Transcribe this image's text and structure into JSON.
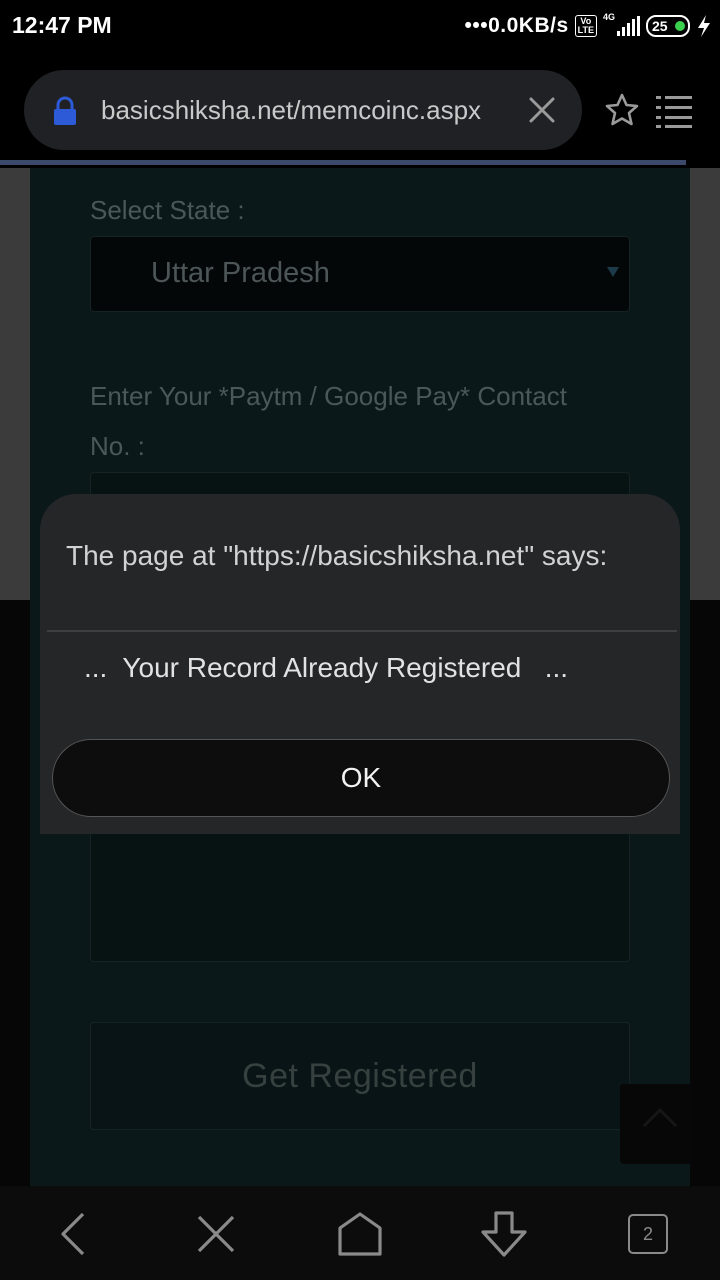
{
  "status_bar": {
    "time": "12:47 PM",
    "net_speed": "•••0.0KB/s",
    "volte_label": "Vo\nLTE",
    "network_type": "4G",
    "battery_level": "25",
    "icons": [
      "volte-icon",
      "signal-icon",
      "battery-icon",
      "charging-icon"
    ]
  },
  "browser": {
    "url": "basicshiksha.net/memcoinc.aspx",
    "icons": [
      "lock-icon",
      "clear-icon",
      "star-icon",
      "menu-icon"
    ]
  },
  "form": {
    "state_label": "Select State :",
    "state_value": "Uttar Pradesh",
    "contact_label_line1": "Enter Your *Paytm / Google Pay* Contact",
    "contact_label_line2": "No. :",
    "submit_label": "Get Registered"
  },
  "dialog": {
    "title": "The page at \"https://basicshiksha.net\" says:",
    "message": "...  Your Record Already Registered   ...",
    "ok_label": "OK"
  },
  "bottom_nav": {
    "tab_count": "2",
    "icons": [
      "back-icon",
      "close-icon",
      "home-icon",
      "download-icon",
      "tabs-icon"
    ]
  },
  "colors": {
    "dialog_bg": "#252628",
    "form_bg": "#0b1819",
    "accent_lock": "#2d5bd7"
  }
}
